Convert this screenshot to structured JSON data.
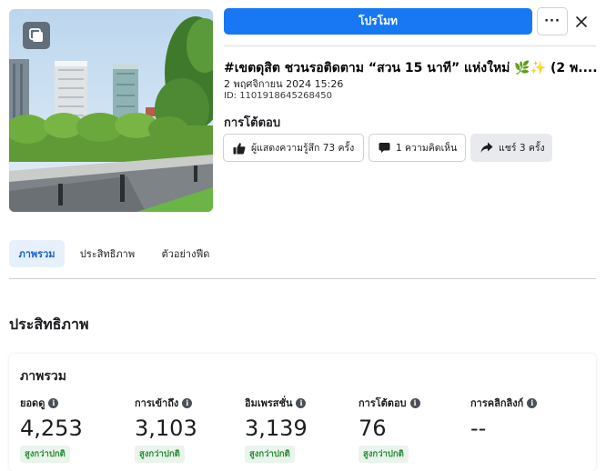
{
  "header": {
    "promote_label": "โปรโมท",
    "more_label": "···",
    "post_title": "#เขตดุสิต ชวนรอติดตาม “สวน 15 นาที” แห่งใหม่ 🌿✨ (2 พ....",
    "post_date": "2 พฤศจิกายน 2024 15:26",
    "post_id": "ID: 1101918645268450"
  },
  "reactions": {
    "heading": "การโต้ตอบ",
    "likes_label": "ผู้แสดงความรู้สึก 73 ครั้ง",
    "comments_label": "1 ความคิดเห็น",
    "shares_label": "แชร์ 3 ครั้ง"
  },
  "tabs": [
    {
      "label": "ภาพรวม",
      "active": true
    },
    {
      "label": "ประสิทธิภาพ",
      "active": false
    },
    {
      "label": "ตัวอย่างฟีด",
      "active": false
    }
  ],
  "performance": {
    "heading": "ประสิทธิภาพ",
    "card_title": "ภาพรวม",
    "metrics": [
      {
        "label": "ยอดดู",
        "value": "4,253",
        "badge": "สูงกว่าปกติ"
      },
      {
        "label": "การเข้าถึง",
        "value": "3,103",
        "badge": "สูงกว่าปกติ"
      },
      {
        "label": "อิมเพรสชั่น",
        "value": "3,139",
        "badge": "สูงกว่าปกติ"
      },
      {
        "label": "การโต้ตอบ",
        "value": "76",
        "badge": "สูงกว่าปกติ"
      },
      {
        "label": "การคลิกลิงก์",
        "value": "--",
        "badge": ""
      }
    ]
  },
  "colors": {
    "accent": "#1877f2",
    "tab_active_bg": "#e7f0fd",
    "badge_bg": "#e9f5ec",
    "badge_text": "#2f8a3c"
  },
  "icons": {
    "album": "album-icon",
    "close": "close-icon",
    "like": "thumbs-up-icon",
    "comment": "comment-bubble-icon",
    "share": "share-arrow-icon",
    "info": "info-icon"
  }
}
